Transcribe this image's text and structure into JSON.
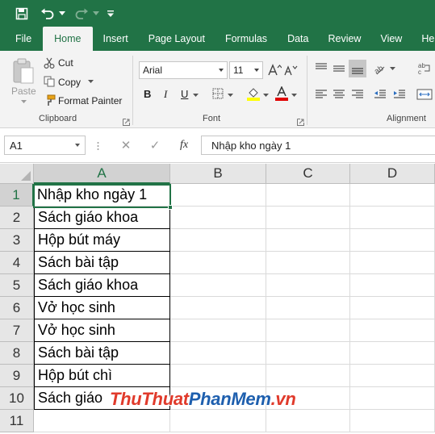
{
  "tabs": [
    "File",
    "Home",
    "Insert",
    "Page Layout",
    "Formulas",
    "Data",
    "Review",
    "View",
    "He"
  ],
  "active_tab": "Home",
  "clipboard": {
    "paste": "Paste",
    "cut": "Cut",
    "copy": "Copy",
    "format_painter": "Format Painter",
    "group_label": "Clipboard"
  },
  "font": {
    "name": "Arial",
    "size": "11",
    "group_label": "Font",
    "bold": "B",
    "italic": "I",
    "underline": "U"
  },
  "alignment": {
    "group_label": "Alignment"
  },
  "formula_bar": {
    "name_box": "A1",
    "cancel": "✕",
    "enter": "✓",
    "fx": "fx",
    "value": "Nhập kho ngày 1"
  },
  "grid": {
    "columns": [
      "A",
      "B",
      "C",
      "D"
    ],
    "rows": [
      "1",
      "2",
      "3",
      "4",
      "5",
      "6",
      "7",
      "8",
      "9",
      "10",
      "11"
    ],
    "cells_a": [
      "Nhập kho ngày 1",
      "Sách giáo khoa",
      "Hộp bút máy",
      "Sách bài tập",
      "Sách giáo khoa",
      "Vở học sinh",
      "Vở học sinh",
      "Sách bài tập",
      "Hộp bút chì",
      "Sách giáo",
      ""
    ]
  },
  "watermark": {
    "part1": "ThuThuat",
    "part2": "PhanMem",
    "part3": ".vn"
  },
  "colors": {
    "accent": "#217346",
    "ribbon_bg": "#f3f3f3",
    "header_bg": "#e6e6e6"
  }
}
